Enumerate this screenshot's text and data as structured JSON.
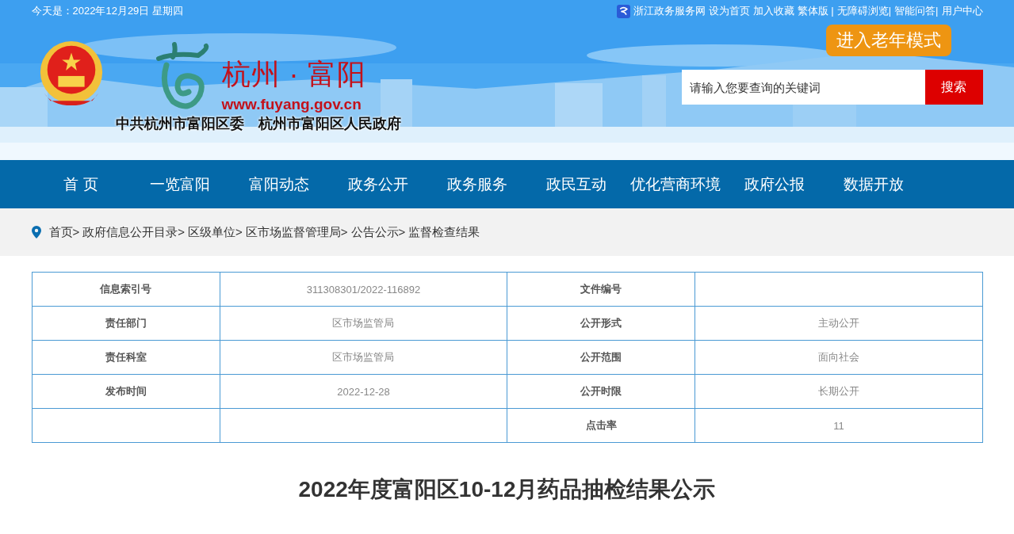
{
  "top_bar": {
    "date": "今天是：2022年12月29日 星期四",
    "service_link": "浙江政务服务网",
    "links": [
      "设为首页",
      "加入收藏",
      "繁体版 |",
      "无障碍浏览|",
      "智能问答|",
      "用户中心"
    ]
  },
  "header": {
    "site_name": "杭州 · 富阳",
    "site_url": "www.fuyang.gov.cn",
    "organizations": [
      "中共杭州市富阳区委",
      "杭州市富阳区人民政府"
    ],
    "elder_mode_button": "进入老年模式",
    "search": {
      "placeholder": "请输入您要查询的关键词",
      "button": "搜索"
    }
  },
  "nav": [
    "首 页",
    "一览富阳",
    "富阳动态",
    "政务公开",
    "政务服务",
    "政民互动",
    "优化营商环境",
    "政府公报",
    "数据开放"
  ],
  "breadcrumb": [
    "首页>",
    "政府信息公开目录>",
    "区级单位>",
    "区市场监督管理局>",
    "公告公示>",
    "监督检查结果"
  ],
  "info_table": [
    {
      "label_1": "信息索引号",
      "value_1": "311308301/2022-116892",
      "label_2": "文件编号"
    },
    {
      "label_1": "责任部门",
      "value_1": "区市场监管局",
      "label_2": "公开形式",
      "value_2": "主动公开"
    },
    {
      "label_1": "责任科室",
      "value_1": "区市场监管局",
      "label_2": "公开范围",
      "value_2": "面向社会"
    },
    {
      "label_1": "发布时间",
      "value_1": "2022-12-28",
      "label_2": "公开时限",
      "value_2": "长期公开"
    },
    {
      "label_2": "点击率",
      "value_2": "11"
    }
  ],
  "article_title": "2022年度富阳区10-12月药品抽检结果公示"
}
